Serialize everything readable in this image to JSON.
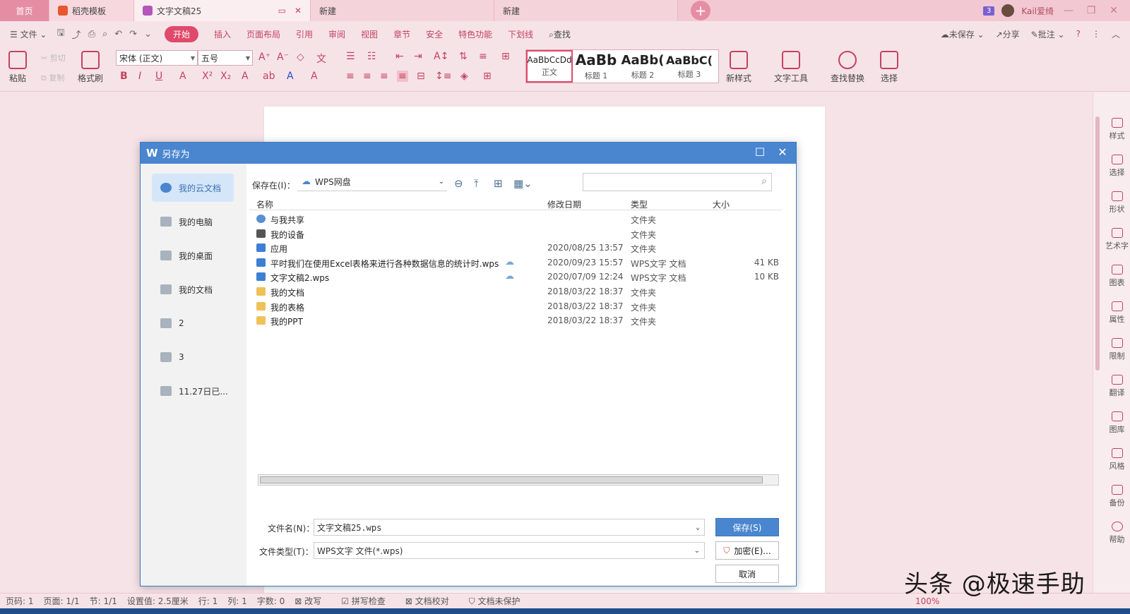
{
  "tabs": {
    "home": "首页",
    "template": "稻壳模板",
    "doc": "文字文稿25",
    "new1": "新建",
    "new2": "新建",
    "badge": "3",
    "user": "Kail爱绮"
  },
  "menu": {
    "file": "文件",
    "items": [
      "开始",
      "插入",
      "页面布局",
      "引用",
      "审阅",
      "视图",
      "章节",
      "安全",
      "特色功能",
      "下划线"
    ],
    "find": "查找",
    "unsaved": "未保存",
    "share": "分享",
    "comment": "批注"
  },
  "ribbon": {
    "paste": "粘贴",
    "cut": "剪切",
    "copy": "复制",
    "format_painter": "格式刷",
    "font": "宋体 (正文)",
    "size": "五号",
    "styles": [
      {
        "preview": "AaBbCcDd",
        "label": "正文"
      },
      {
        "preview": "AaBb",
        "label": "标题 1"
      },
      {
        "preview": "AaBb(",
        "label": "标题 2"
      },
      {
        "preview": "AaBbC(",
        "label": "标题 3"
      }
    ],
    "new_style": "新样式",
    "text_tools": "文字工具",
    "find_replace": "查找替换",
    "select": "选择"
  },
  "right_panel": [
    "样式",
    "选择",
    "形状",
    "艺术字",
    "图表",
    "属性",
    "限制",
    "翻译",
    "图库",
    "风格",
    "备份",
    "帮助"
  ],
  "dialog": {
    "title": "另存为",
    "sidebar": [
      "我的云文档",
      "我的电脑",
      "我的桌面",
      "我的文档",
      "2",
      "3",
      "11.27日已..."
    ],
    "save_in_label": "保存在(I)：",
    "location": "WPS网盘",
    "columns": {
      "name": "名称",
      "date": "修改日期",
      "type": "类型",
      "size": "大小"
    },
    "files": [
      {
        "name": "与我共享",
        "date": "",
        "type": "文件夹",
        "size": "",
        "icon": "share-icon",
        "cloud": false
      },
      {
        "name": "我的设备",
        "date": "",
        "type": "文件夹",
        "size": "",
        "icon": "device-icon",
        "cloud": false
      },
      {
        "name": "应用",
        "date": "2020/08/25 13:57",
        "type": "文件夹",
        "size": "",
        "icon": "app-icon",
        "cloud": false
      },
      {
        "name": "平时我们在使用Excel表格来进行各种数据信息的统计时.wps",
        "date": "2020/09/23 15:57",
        "type": "WPS文字 文档",
        "size": "41 KB",
        "icon": "wps-doc-icon",
        "cloud": true
      },
      {
        "name": "文字文稿2.wps",
        "date": "2020/07/09 12:24",
        "type": "WPS文字 文档",
        "size": "10 KB",
        "icon": "wps-doc-icon",
        "cloud": true
      },
      {
        "name": "我的文档",
        "date": "2018/03/22 18:37",
        "type": "文件夹",
        "size": "",
        "icon": "folder-icon",
        "cloud": false
      },
      {
        "name": "我的表格",
        "date": "2018/03/22 18:37",
        "type": "文件夹",
        "size": "",
        "icon": "folder-icon",
        "cloud": false
      },
      {
        "name": "我的PPT",
        "date": "2018/03/22 18:37",
        "type": "文件夹",
        "size": "",
        "icon": "folder-icon",
        "cloud": false
      }
    ],
    "filename_label": "文件名(N)：",
    "filename": "文字文稿25.wps",
    "filetype_label": "文件类型(T)：",
    "filetype": "WPS文字 文件(*.wps)",
    "save_button": "保存(S)",
    "encrypt_button": "加密(E)...",
    "cancel_button": "取消"
  },
  "status": {
    "page_no": "页码: 1",
    "pages": "页面: 1/1",
    "section": "节: 1/1",
    "setting": "设置值: 2.5厘米",
    "row": "行: 1",
    "col": "列: 1",
    "words": "字数: 0",
    "revise": "改写",
    "spell": "拼写检查",
    "proof": "文档校对",
    "protect": "文档未保护",
    "zoom": "100%"
  },
  "watermark": "头条 @极速手助"
}
